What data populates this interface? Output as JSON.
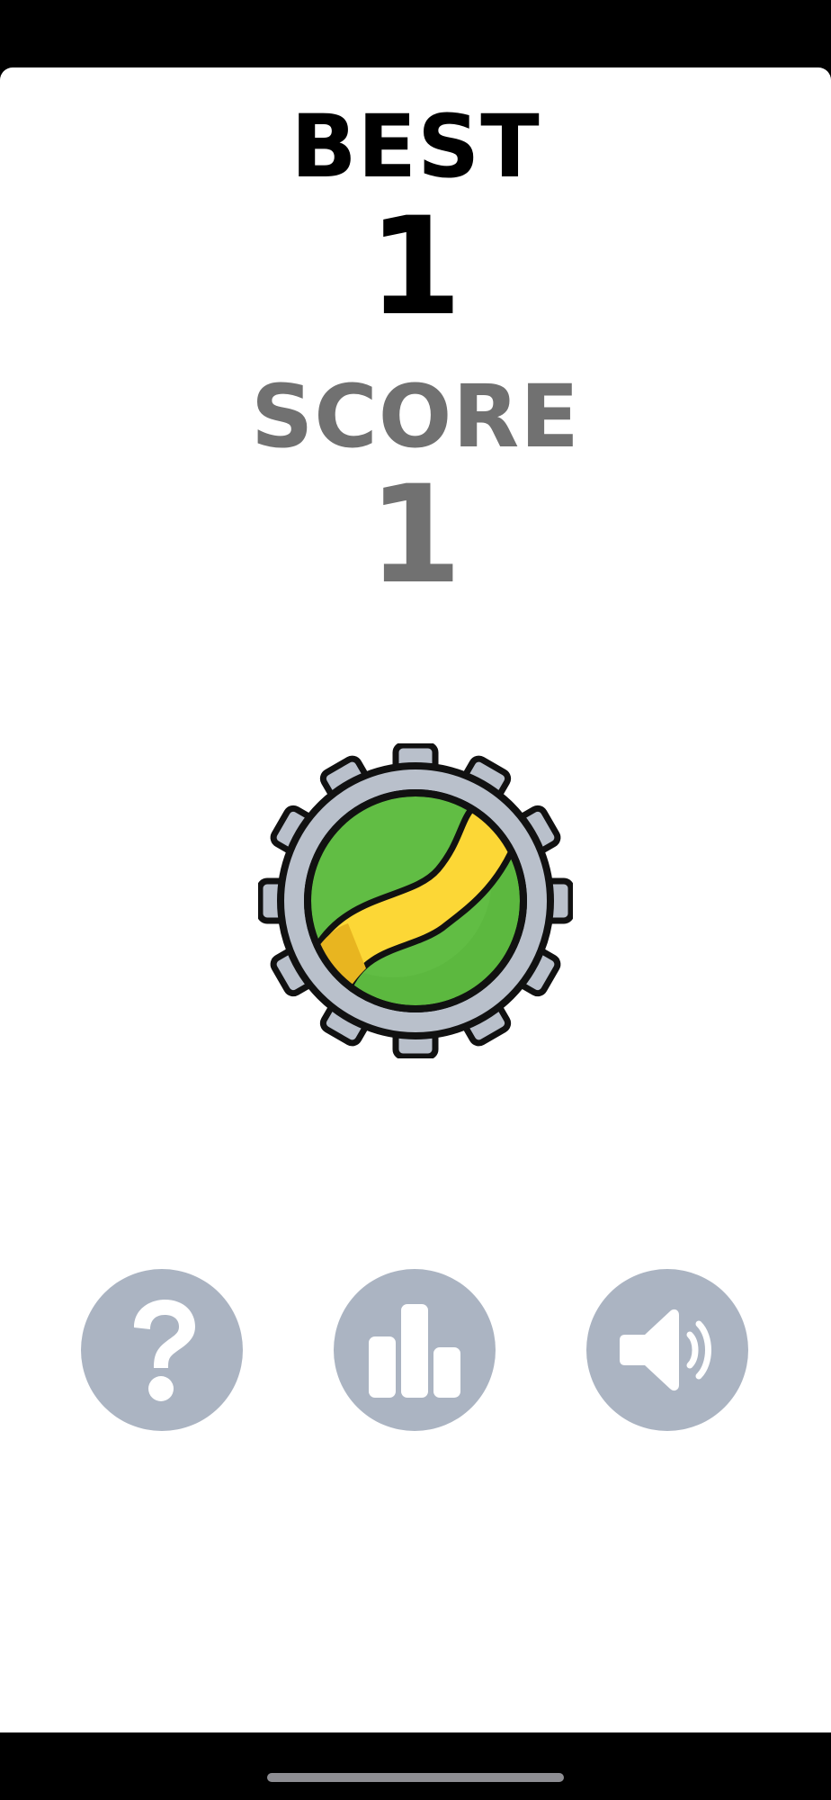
{
  "scoreboard": {
    "best_label": "BEST",
    "best_value": "1",
    "score_label": "SCORE",
    "score_value": "1"
  },
  "game_piece": {
    "icon": "gear-ball-icon",
    "colors": {
      "gear": "#b9c0cb",
      "ball": "#5cb83f",
      "stripe": "#fcd736"
    }
  },
  "controls": [
    {
      "name": "help-button",
      "icon": "question-mark-icon"
    },
    {
      "name": "leaderboard-button",
      "icon": "bar-chart-icon"
    },
    {
      "name": "sound-button",
      "icon": "speaker-icon"
    }
  ],
  "colors": {
    "best_text": "#000000",
    "score_text": "#717171",
    "button_bg": "#abb4c2",
    "button_icon": "#ffffff"
  }
}
